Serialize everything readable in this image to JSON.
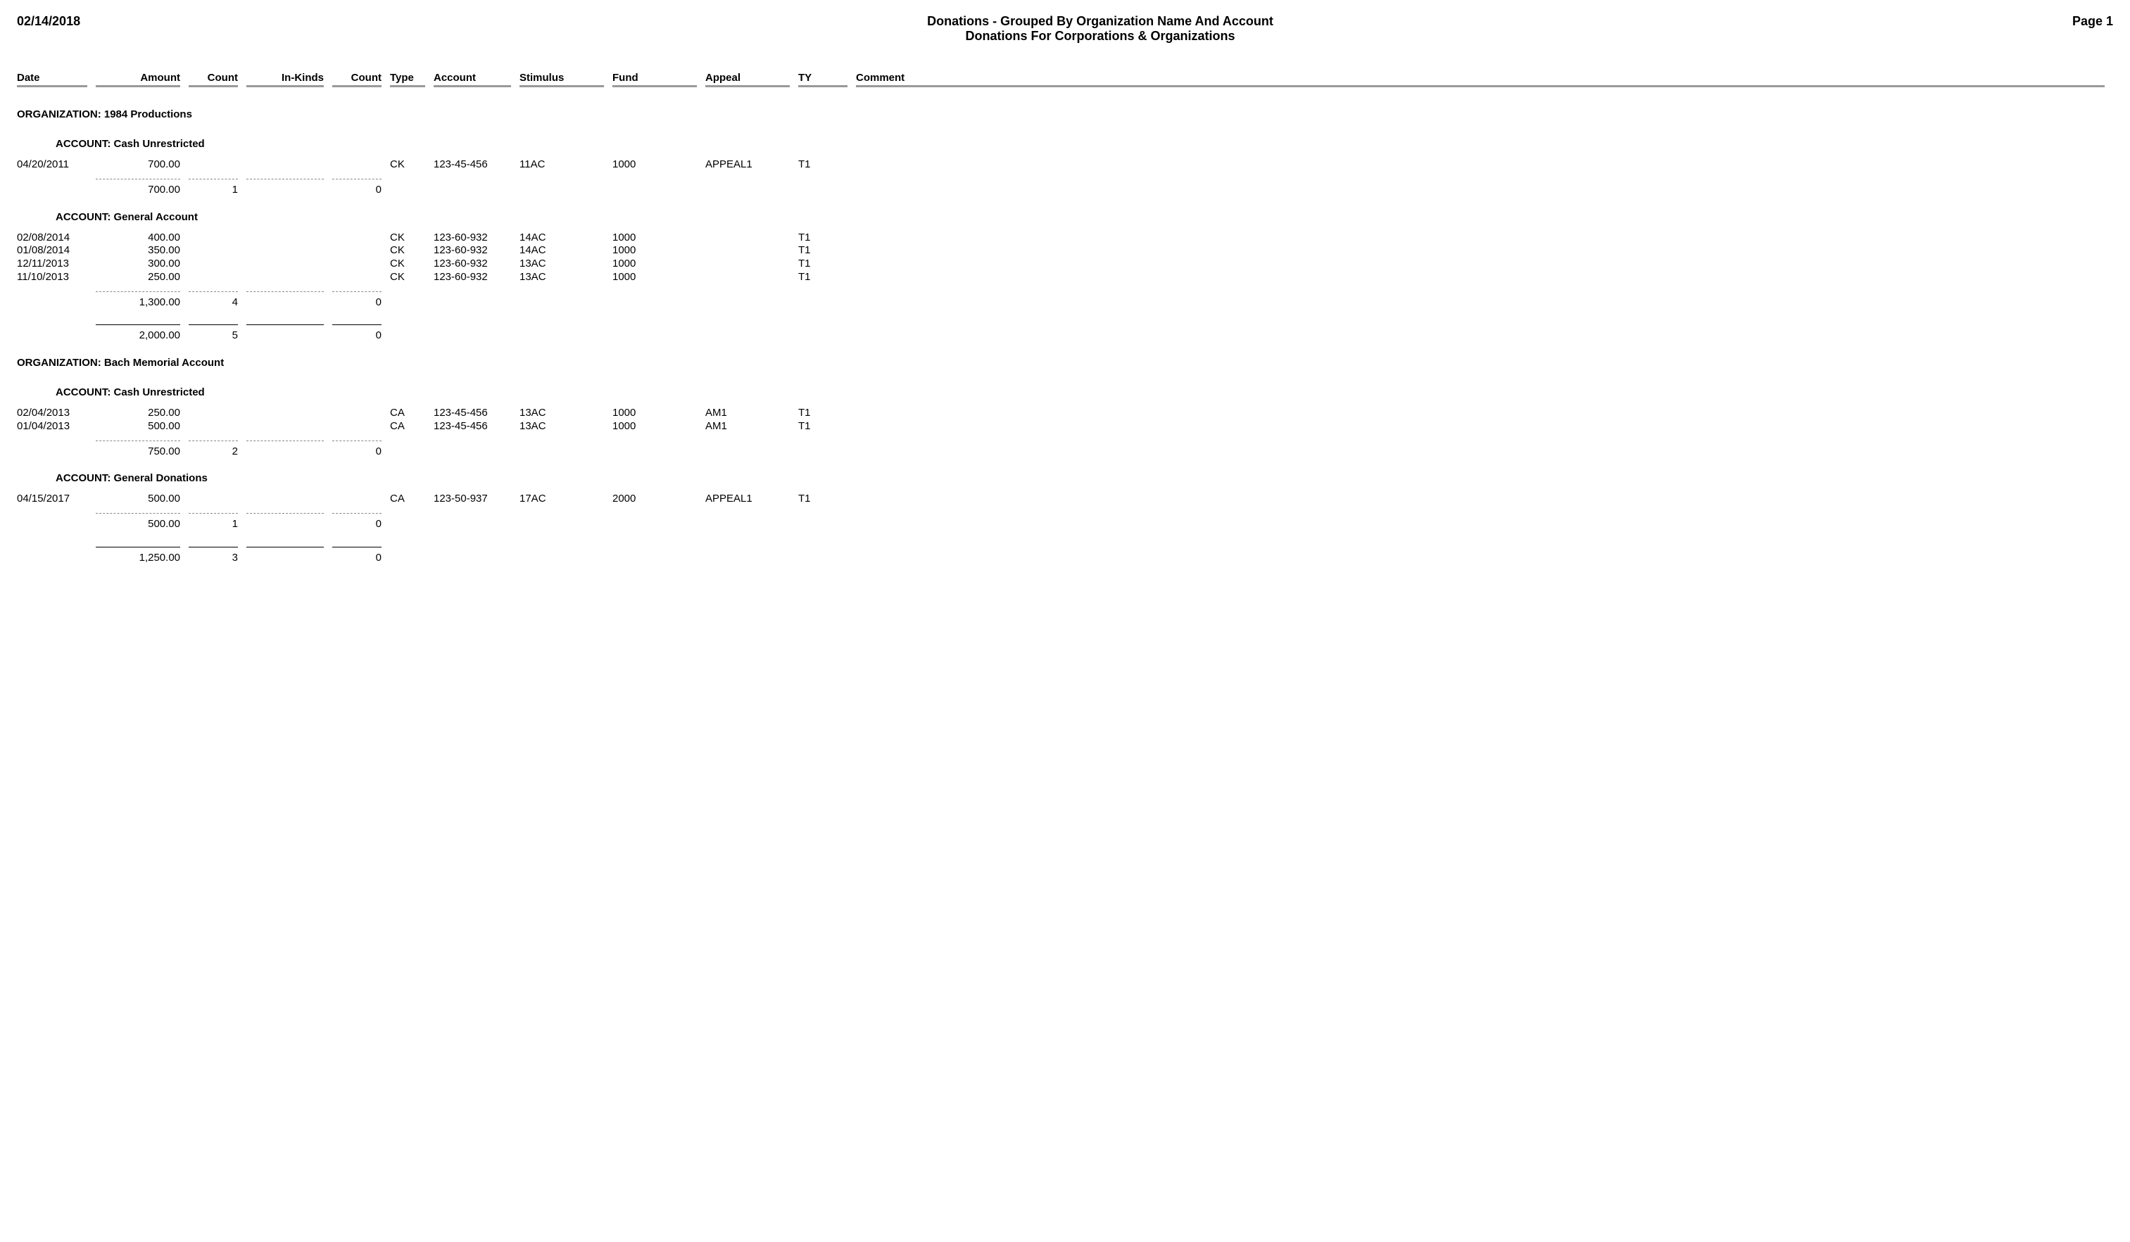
{
  "header": {
    "date": "02/14/2018",
    "title": "Donations - Grouped By Organization Name And Account",
    "subtitle": "Donations For Corporations & Organizations",
    "page": "Page 1"
  },
  "columns": {
    "date": "Date",
    "amount": "Amount",
    "count1": "Count",
    "inkinds": "In-Kinds",
    "count2": "Count",
    "type": "Type",
    "account": "Account",
    "stimulus": "Stimulus",
    "fund": "Fund",
    "appeal": "Appeal",
    "ty": "TY",
    "comment": "Comment"
  },
  "orgs": [
    {
      "label": "ORGANIZATION: 1984 Productions",
      "accounts": [
        {
          "label": "ACCOUNT: Cash Unrestricted",
          "rows": [
            {
              "date": "04/20/2011",
              "amount": "700.00",
              "type": "CK",
              "account": "123-45-456",
              "stimulus": "11AC",
              "fund": "1000",
              "appeal": "APPEAL1",
              "ty": "T1",
              "comment": ""
            }
          ],
          "subtotal": {
            "amount": "700.00",
            "count1": "1",
            "inkinds": "",
            "count2": "0"
          }
        },
        {
          "label": "ACCOUNT: General Account",
          "rows": [
            {
              "date": "02/08/2014",
              "amount": "400.00",
              "type": "CK",
              "account": "123-60-932",
              "stimulus": "14AC",
              "fund": "1000",
              "appeal": "",
              "ty": "T1",
              "comment": ""
            },
            {
              "date": "01/08/2014",
              "amount": "350.00",
              "type": "CK",
              "account": "123-60-932",
              "stimulus": "14AC",
              "fund": "1000",
              "appeal": "",
              "ty": "T1",
              "comment": ""
            },
            {
              "date": "12/11/2013",
              "amount": "300.00",
              "type": "CK",
              "account": "123-60-932",
              "stimulus": "13AC",
              "fund": "1000",
              "appeal": "",
              "ty": "T1",
              "comment": ""
            },
            {
              "date": "11/10/2013",
              "amount": "250.00",
              "type": "CK",
              "account": "123-60-932",
              "stimulus": "13AC",
              "fund": "1000",
              "appeal": "",
              "ty": "T1",
              "comment": ""
            }
          ],
          "subtotal": {
            "amount": "1,300.00",
            "count1": "4",
            "inkinds": "",
            "count2": "0"
          }
        }
      ],
      "orgtotal": {
        "amount": "2,000.00",
        "count1": "5",
        "inkinds": "",
        "count2": "0"
      }
    },
    {
      "label": "ORGANIZATION: Bach Memorial Account",
      "accounts": [
        {
          "label": "ACCOUNT: Cash Unrestricted",
          "rows": [
            {
              "date": "02/04/2013",
              "amount": "250.00",
              "type": "CA",
              "account": "123-45-456",
              "stimulus": "13AC",
              "fund": "1000",
              "appeal": "AM1",
              "ty": "T1",
              "comment": ""
            },
            {
              "date": "01/04/2013",
              "amount": "500.00",
              "type": "CA",
              "account": "123-45-456",
              "stimulus": "13AC",
              "fund": "1000",
              "appeal": "AM1",
              "ty": "T1",
              "comment": ""
            }
          ],
          "subtotal": {
            "amount": "750.00",
            "count1": "2",
            "inkinds": "",
            "count2": "0"
          }
        },
        {
          "label": "ACCOUNT: General Donations",
          "rows": [
            {
              "date": "04/15/2017",
              "amount": "500.00",
              "type": "CA",
              "account": "123-50-937",
              "stimulus": "17AC",
              "fund": "2000",
              "appeal": "APPEAL1",
              "ty": "T1",
              "comment": ""
            }
          ],
          "subtotal": {
            "amount": "500.00",
            "count1": "1",
            "inkinds": "",
            "count2": "0"
          }
        }
      ],
      "orgtotal": {
        "amount": "1,250.00",
        "count1": "3",
        "inkinds": "",
        "count2": "0"
      }
    }
  ]
}
